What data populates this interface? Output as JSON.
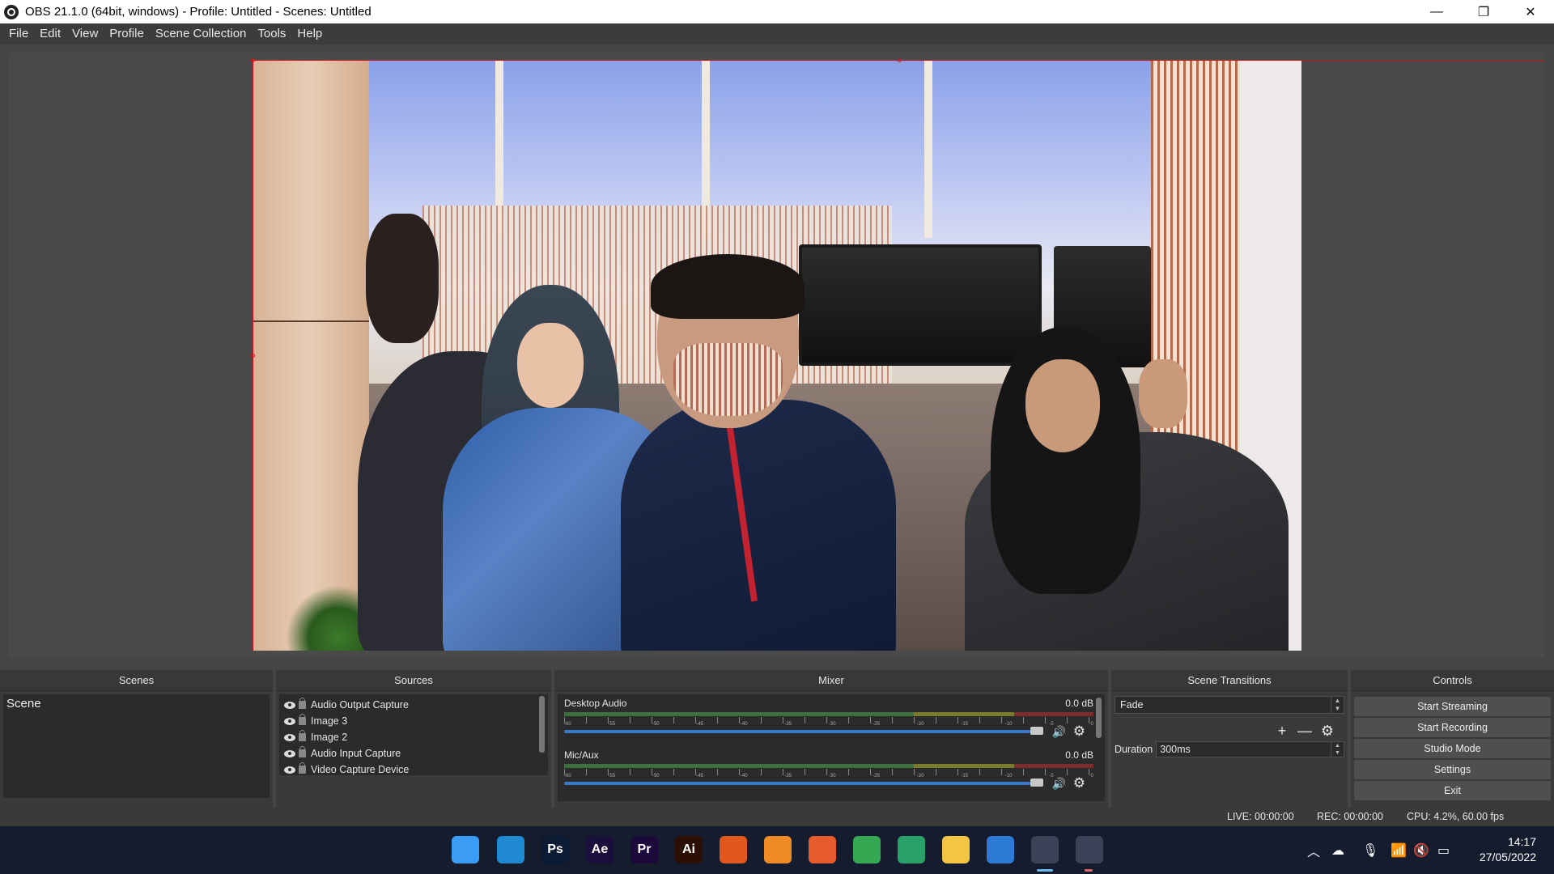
{
  "window": {
    "title": "OBS 21.1.0 (64bit, windows) - Profile: Untitled - Scenes: Untitled",
    "minimize": "—",
    "restore": "❐",
    "close": "✕"
  },
  "menu": [
    "File",
    "Edit",
    "View",
    "Profile",
    "Scene Collection",
    "Tools",
    "Help"
  ],
  "docks": {
    "scenes": {
      "header": "Scenes",
      "items": [
        "Scene"
      ]
    },
    "sources": {
      "header": "Sources",
      "items": [
        "Audio Output Capture",
        "Image 3",
        "Image 2",
        "Audio Input Capture",
        "Video Capture Device"
      ]
    },
    "mixer": {
      "header": "Mixer",
      "channels": [
        {
          "name": "Desktop Audio",
          "db": "0.0 dB"
        },
        {
          "name": "Mic/Aux",
          "db": "0.0 dB"
        }
      ],
      "tick_labels": [
        "-60",
        "-55",
        "-50",
        "-45",
        "-40",
        "-35",
        "-30",
        "-25",
        "-20",
        "-15",
        "-10",
        "-5",
        "0"
      ]
    },
    "transitions": {
      "header": "Scene Transitions",
      "selected": "Fade",
      "duration_label": "Duration",
      "duration_value": "300ms"
    },
    "controls": {
      "header": "Controls",
      "buttons": [
        "Start Streaming",
        "Start Recording",
        "Studio Mode",
        "Settings",
        "Exit"
      ]
    }
  },
  "toolbar_symbols": {
    "add": "+",
    "remove": "—",
    "up": "︿",
    "down": "﹀",
    "gear": "⚙",
    "volume": "🔊"
  },
  "status": {
    "live": "LIVE: 00:00:00",
    "rec": "REC: 00:00:00",
    "cpu": "CPU: 4.2%, 60.00 fps"
  },
  "taskbar": {
    "apps": [
      {
        "name": "windows-start",
        "label": "",
        "color": "#3b9cf5"
      },
      {
        "name": "vscode",
        "label": "",
        "color": "#1f8ad2"
      },
      {
        "name": "photoshop",
        "label": "Ps",
        "color": "#0a1b33"
      },
      {
        "name": "after-effects",
        "label": "Ae",
        "color": "#1a0f3a"
      },
      {
        "name": "premiere",
        "label": "Pr",
        "color": "#1c0a3a"
      },
      {
        "name": "illustrator",
        "label": "Ai",
        "color": "#2b0f02"
      },
      {
        "name": "ubuntu",
        "label": "",
        "color": "#e2571e"
      },
      {
        "name": "blender",
        "label": "",
        "color": "#f08a24"
      },
      {
        "name": "firefox",
        "label": "",
        "color": "#e55b2d"
      },
      {
        "name": "chrome",
        "label": "",
        "color": "#34a853"
      },
      {
        "name": "edge",
        "label": "",
        "color": "#2aa06a"
      },
      {
        "name": "file-explorer",
        "label": "",
        "color": "#f4c542"
      },
      {
        "name": "microsoft-store",
        "label": "",
        "color": "#2d7ad6"
      },
      {
        "name": "obs",
        "label": "",
        "color": "#2a2a2a"
      },
      {
        "name": "notes",
        "label": "",
        "color": "#f2c230"
      }
    ],
    "time": "14:17",
    "date": "27/05/2022"
  }
}
